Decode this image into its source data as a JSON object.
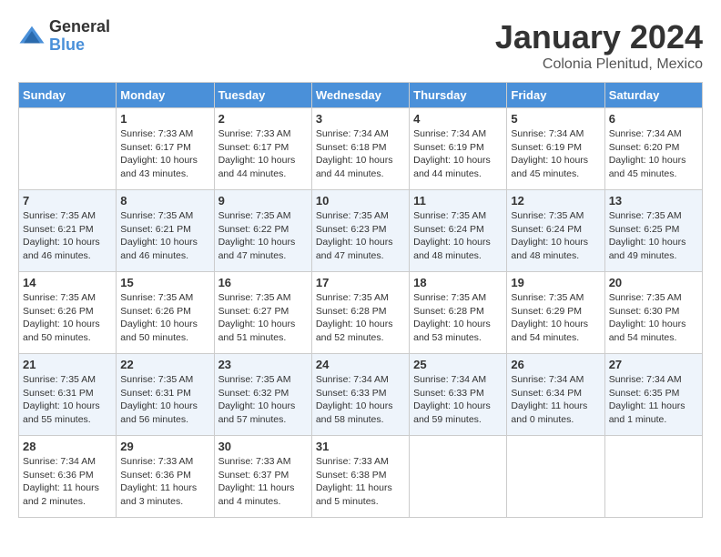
{
  "header": {
    "logo_general": "General",
    "logo_blue": "Blue",
    "month_title": "January 2024",
    "subtitle": "Colonia Plenitud, Mexico"
  },
  "days_of_week": [
    "Sunday",
    "Monday",
    "Tuesday",
    "Wednesday",
    "Thursday",
    "Friday",
    "Saturday"
  ],
  "weeks": [
    [
      {
        "day": "",
        "info": ""
      },
      {
        "day": "1",
        "info": "Sunrise: 7:33 AM\nSunset: 6:17 PM\nDaylight: 10 hours\nand 43 minutes."
      },
      {
        "day": "2",
        "info": "Sunrise: 7:33 AM\nSunset: 6:17 PM\nDaylight: 10 hours\nand 44 minutes."
      },
      {
        "day": "3",
        "info": "Sunrise: 7:34 AM\nSunset: 6:18 PM\nDaylight: 10 hours\nand 44 minutes."
      },
      {
        "day": "4",
        "info": "Sunrise: 7:34 AM\nSunset: 6:19 PM\nDaylight: 10 hours\nand 44 minutes."
      },
      {
        "day": "5",
        "info": "Sunrise: 7:34 AM\nSunset: 6:19 PM\nDaylight: 10 hours\nand 45 minutes."
      },
      {
        "day": "6",
        "info": "Sunrise: 7:34 AM\nSunset: 6:20 PM\nDaylight: 10 hours\nand 45 minutes."
      }
    ],
    [
      {
        "day": "7",
        "info": "Sunrise: 7:35 AM\nSunset: 6:21 PM\nDaylight: 10 hours\nand 46 minutes."
      },
      {
        "day": "8",
        "info": "Sunrise: 7:35 AM\nSunset: 6:21 PM\nDaylight: 10 hours\nand 46 minutes."
      },
      {
        "day": "9",
        "info": "Sunrise: 7:35 AM\nSunset: 6:22 PM\nDaylight: 10 hours\nand 47 minutes."
      },
      {
        "day": "10",
        "info": "Sunrise: 7:35 AM\nSunset: 6:23 PM\nDaylight: 10 hours\nand 47 minutes."
      },
      {
        "day": "11",
        "info": "Sunrise: 7:35 AM\nSunset: 6:24 PM\nDaylight: 10 hours\nand 48 minutes."
      },
      {
        "day": "12",
        "info": "Sunrise: 7:35 AM\nSunset: 6:24 PM\nDaylight: 10 hours\nand 48 minutes."
      },
      {
        "day": "13",
        "info": "Sunrise: 7:35 AM\nSunset: 6:25 PM\nDaylight: 10 hours\nand 49 minutes."
      }
    ],
    [
      {
        "day": "14",
        "info": "Sunrise: 7:35 AM\nSunset: 6:26 PM\nDaylight: 10 hours\nand 50 minutes."
      },
      {
        "day": "15",
        "info": "Sunrise: 7:35 AM\nSunset: 6:26 PM\nDaylight: 10 hours\nand 50 minutes."
      },
      {
        "day": "16",
        "info": "Sunrise: 7:35 AM\nSunset: 6:27 PM\nDaylight: 10 hours\nand 51 minutes."
      },
      {
        "day": "17",
        "info": "Sunrise: 7:35 AM\nSunset: 6:28 PM\nDaylight: 10 hours\nand 52 minutes."
      },
      {
        "day": "18",
        "info": "Sunrise: 7:35 AM\nSunset: 6:28 PM\nDaylight: 10 hours\nand 53 minutes."
      },
      {
        "day": "19",
        "info": "Sunrise: 7:35 AM\nSunset: 6:29 PM\nDaylight: 10 hours\nand 54 minutes."
      },
      {
        "day": "20",
        "info": "Sunrise: 7:35 AM\nSunset: 6:30 PM\nDaylight: 10 hours\nand 54 minutes."
      }
    ],
    [
      {
        "day": "21",
        "info": "Sunrise: 7:35 AM\nSunset: 6:31 PM\nDaylight: 10 hours\nand 55 minutes."
      },
      {
        "day": "22",
        "info": "Sunrise: 7:35 AM\nSunset: 6:31 PM\nDaylight: 10 hours\nand 56 minutes."
      },
      {
        "day": "23",
        "info": "Sunrise: 7:35 AM\nSunset: 6:32 PM\nDaylight: 10 hours\nand 57 minutes."
      },
      {
        "day": "24",
        "info": "Sunrise: 7:34 AM\nSunset: 6:33 PM\nDaylight: 10 hours\nand 58 minutes."
      },
      {
        "day": "25",
        "info": "Sunrise: 7:34 AM\nSunset: 6:33 PM\nDaylight: 10 hours\nand 59 minutes."
      },
      {
        "day": "26",
        "info": "Sunrise: 7:34 AM\nSunset: 6:34 PM\nDaylight: 11 hours\nand 0 minutes."
      },
      {
        "day": "27",
        "info": "Sunrise: 7:34 AM\nSunset: 6:35 PM\nDaylight: 11 hours\nand 1 minute."
      }
    ],
    [
      {
        "day": "28",
        "info": "Sunrise: 7:34 AM\nSunset: 6:36 PM\nDaylight: 11 hours\nand 2 minutes."
      },
      {
        "day": "29",
        "info": "Sunrise: 7:33 AM\nSunset: 6:36 PM\nDaylight: 11 hours\nand 3 minutes."
      },
      {
        "day": "30",
        "info": "Sunrise: 7:33 AM\nSunset: 6:37 PM\nDaylight: 11 hours\nand 4 minutes."
      },
      {
        "day": "31",
        "info": "Sunrise: 7:33 AM\nSunset: 6:38 PM\nDaylight: 11 hours\nand 5 minutes."
      },
      {
        "day": "",
        "info": ""
      },
      {
        "day": "",
        "info": ""
      },
      {
        "day": "",
        "info": ""
      }
    ]
  ]
}
